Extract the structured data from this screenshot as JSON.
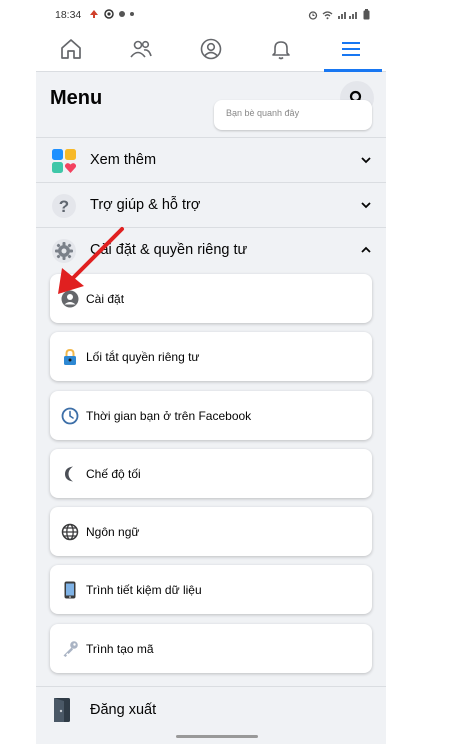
{
  "status_bar": {
    "time": "18:34"
  },
  "tabs": [
    {
      "name": "home",
      "icon": "home-icon"
    },
    {
      "name": "friends",
      "icon": "friends-icon"
    },
    {
      "name": "profile",
      "icon": "profile-icon"
    },
    {
      "name": "notifications",
      "icon": "bell-icon"
    },
    {
      "name": "menu",
      "icon": "hamburger-icon",
      "active": true
    }
  ],
  "header": {
    "title": "Menu"
  },
  "partial_card": {
    "label": "Bạn bè quanh đây"
  },
  "sections": [
    {
      "label": "Xem thêm",
      "icon": "see-more-icon",
      "expanded": false
    },
    {
      "label": "Trợ giúp & hỗ trợ",
      "icon": "help-icon",
      "expanded": false
    },
    {
      "label": "Cài đặt & quyền riêng tư",
      "icon": "settings-gear-icon",
      "expanded": true
    }
  ],
  "settings_items": [
    {
      "label": "Cài đặt",
      "icon": "account-settings-icon"
    },
    {
      "label": "Lối tắt quyền riêng tư",
      "icon": "privacy-lock-icon"
    },
    {
      "label": "Thời gian bạn ở trên Facebook",
      "icon": "clock-icon"
    },
    {
      "label": "Chế độ tối",
      "icon": "moon-icon"
    },
    {
      "label": "Ngôn ngữ",
      "icon": "globe-icon"
    },
    {
      "label": "Trình tiết kiệm dữ liệu",
      "icon": "phone-icon"
    },
    {
      "label": "Trình tạo mã",
      "icon": "key-icon"
    }
  ],
  "logout": {
    "label": "Đăng xuất",
    "icon": "logout-door-icon"
  },
  "colors": {
    "accent": "#1877f2",
    "background": "#f0f2f5",
    "card": "#ffffff",
    "annotation_arrow": "#e02020"
  }
}
